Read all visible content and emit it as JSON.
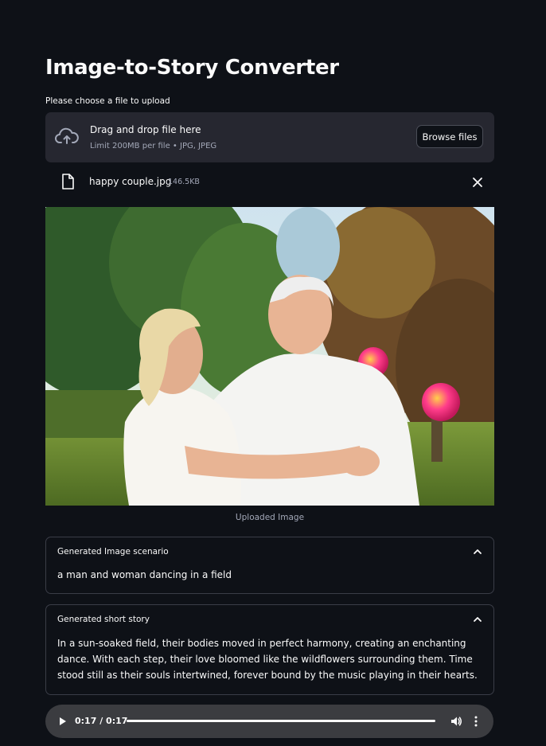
{
  "page": {
    "title": "Image-to-Story Converter"
  },
  "uploader": {
    "label": "Please choose a file to upload",
    "dropzone_title": "Drag and drop file here",
    "dropzone_limit": "Limit 200MB per file • JPG, JPEG",
    "browse_label": "Browse files",
    "icon": "cloud-upload-icon"
  },
  "file": {
    "name": "happy couple.jpg",
    "size": "146.5KB",
    "icon": "file-icon"
  },
  "image": {
    "caption": "Uploaded Image"
  },
  "scenario": {
    "header": "Generated Image scenario",
    "text": "a man and woman dancing in a field"
  },
  "story": {
    "header": "Generated short story",
    "text": "In a sun-soaked field, their bodies moved in perfect harmony, creating an enchanting dance. With each step, their love bloomed like the wildflowers surrounding them. Time stood still as their souls intertwined, forever bound by the music playing in their hearts."
  },
  "audio": {
    "time": "0:17 / 0:17",
    "progress": 1.0
  },
  "colors": {
    "background": "#0e1117",
    "dropzone": "#262730",
    "text": "#fafafa",
    "muted": "#a3a8b8",
    "audio_bar": "#3b3c40"
  }
}
